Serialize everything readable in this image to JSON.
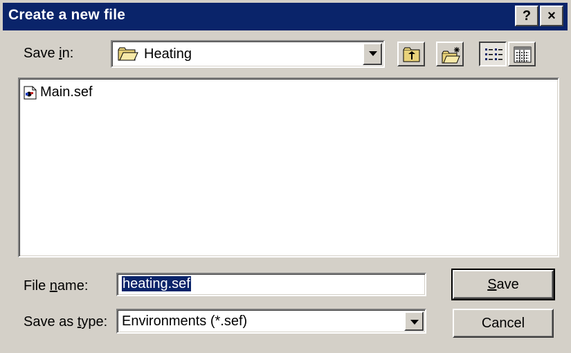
{
  "window": {
    "title": "Create a new file",
    "help_glyph": "?",
    "close_glyph": "×"
  },
  "save_in": {
    "label_pre": "Save ",
    "label_mnemonic": "i",
    "label_post": "n:",
    "folder_name": "Heating",
    "folder_icon": "folder-icon"
  },
  "toolbar": {
    "icons": [
      "up-one-level-icon",
      "create-new-folder-icon",
      "list-view-icon",
      "details-view-icon"
    ],
    "active_view": "list-view-icon"
  },
  "file_list": {
    "items": [
      {
        "name": "Main.sef",
        "icon": "sef-file-icon"
      }
    ]
  },
  "file_name": {
    "label_pre": "File ",
    "label_mnemonic": "n",
    "label_post": "ame:",
    "value": "heating.sef"
  },
  "save_as_type": {
    "label_pre": "Save as ",
    "label_mnemonic": "t",
    "label_post": "ype:",
    "value": "Environments (*.sef)"
  },
  "buttons": {
    "save_mnemonic": "S",
    "save_rest": "ave",
    "cancel": "Cancel"
  },
  "colors": {
    "titlebar": "#0a246a",
    "face": "#d4d0c8",
    "selection": "#0a246a"
  }
}
